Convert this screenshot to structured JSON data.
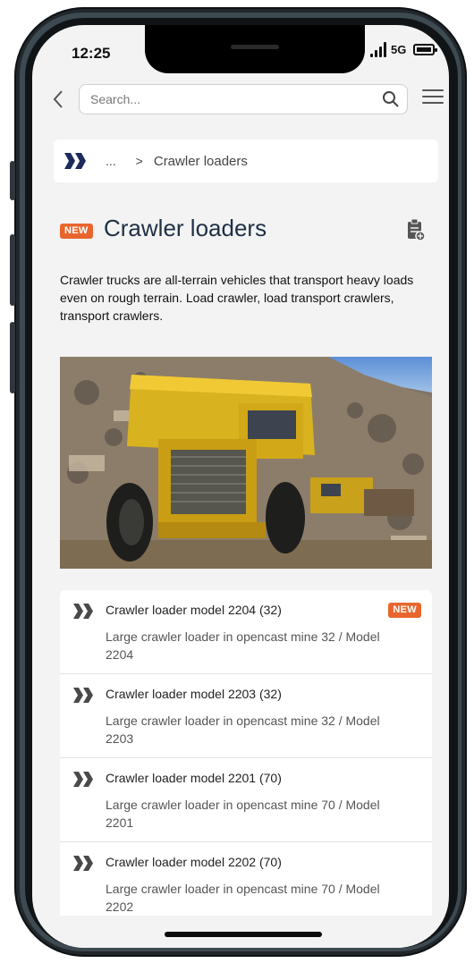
{
  "status_bar": {
    "time": "12:25",
    "network": "5G"
  },
  "header": {
    "search_placeholder": "Search...",
    "back_icon": "chevron-left-icon",
    "search_icon": "magnifier-icon",
    "menu_icon": "hamburger-icon"
  },
  "breadcrumb": {
    "home_icon": "double-chevron-icon",
    "ellipsis": "...",
    "separator": ">",
    "current": "Crawler loaders"
  },
  "page": {
    "badge": "NEW",
    "title": "Crawler loaders",
    "description": "Crawler trucks are all-terrain vehicles that transport heavy loads even on rough terrain. Load crawler, load transport crawlers, transport crawlers.",
    "clipboard_icon": "clipboard-plus-icon"
  },
  "colors": {
    "accent": "#e8662e",
    "title": "#1f3046",
    "brand_navy": "#1c2a5c",
    "list_icon": "#4a4a4a"
  },
  "products": [
    {
      "title": "Crawler loader model 2204 (32)",
      "description": "Large crawler loader in opencast mine 32 / Model 2204",
      "badge": "NEW"
    },
    {
      "title": "Crawler loader model 2203 (32)",
      "description": "Large crawler loader in opencast mine 32 / Model 2203",
      "badge": ""
    },
    {
      "title": "Crawler loader model 2201 (70)",
      "description": "Large crawler loader in opencast mine 70 / Model 2201",
      "badge": ""
    },
    {
      "title": "Crawler loader model 2202 (70)",
      "description": "Large crawler loader in opencast mine 70 / Model 2202",
      "badge": ""
    }
  ]
}
